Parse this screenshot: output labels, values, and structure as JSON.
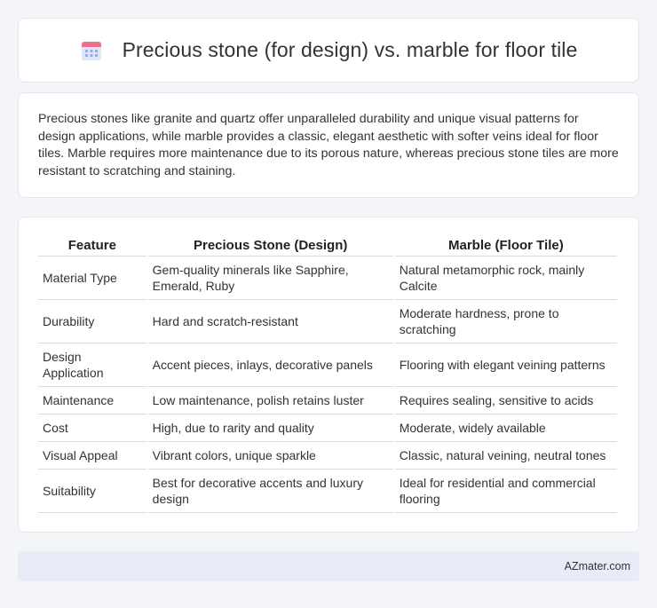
{
  "header": {
    "title": "Precious stone (for design) vs. marble for floor tile",
    "icon": "calendar-icon"
  },
  "summary": {
    "text": "Precious stones like granite and quartz offer unparalleled durability and unique visual patterns for design applications, while marble provides a classic, elegant aesthetic with softer veins ideal for floor tiles. Marble requires more maintenance due to its porous nature, whereas precious stone tiles are more resistant to scratching and staining."
  },
  "table": {
    "headers": [
      "Feature",
      "Precious Stone (Design)",
      "Marble (Floor Tile)"
    ],
    "rows": [
      [
        "Material Type",
        "Gem-quality minerals like Sapphire, Emerald, Ruby",
        "Natural metamorphic rock, mainly Calcite"
      ],
      [
        "Durability",
        "Hard and scratch-resistant",
        "Moderate hardness, prone to scratching"
      ],
      [
        "Design Application",
        "Accent pieces, inlays, decorative panels",
        "Flooring with elegant veining patterns"
      ],
      [
        "Maintenance",
        "Low maintenance, polish retains luster",
        "Requires sealing, sensitive to acids"
      ],
      [
        "Cost",
        "High, due to rarity and quality",
        "Moderate, widely available"
      ],
      [
        "Visual Appeal",
        "Vibrant colors, unique sparkle",
        "Classic, natural veining, neutral tones"
      ],
      [
        "Suitability",
        "Best for decorative accents and luxury design",
        "Ideal for residential and commercial flooring"
      ]
    ]
  },
  "footer": {
    "brand": "AZmater.com"
  },
  "colors": {
    "icon_accent": "#7b9cf0",
    "icon_header": "#f06f8c",
    "footer_bg": "#e8ecf6"
  }
}
